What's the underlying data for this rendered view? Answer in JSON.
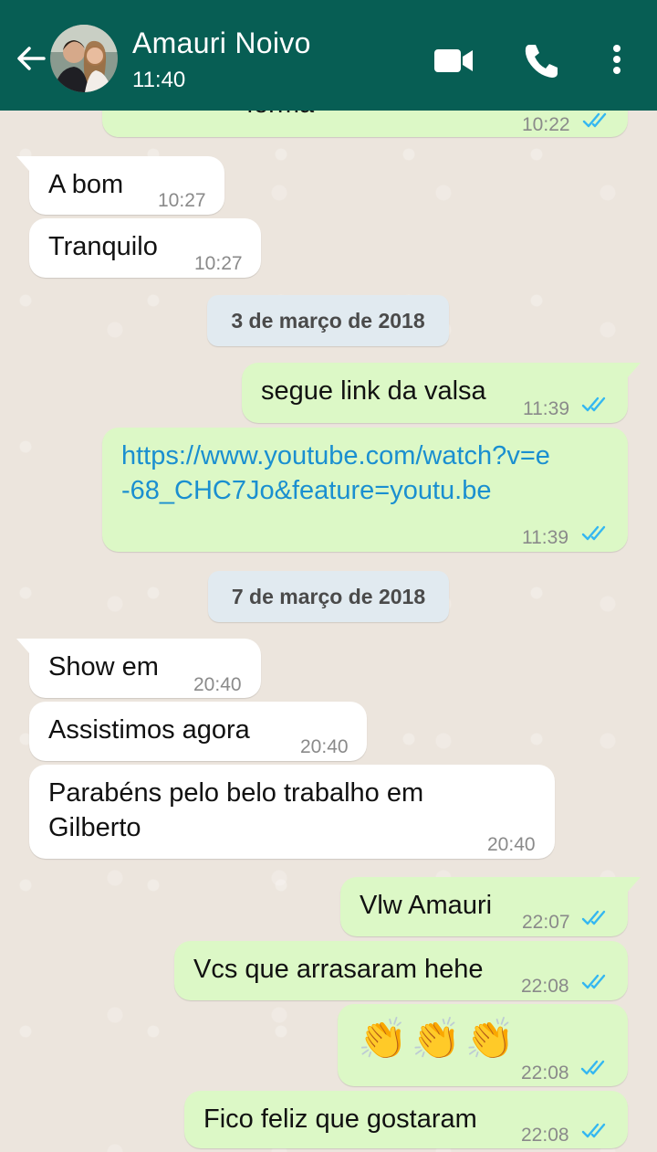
{
  "header": {
    "contact_name": "Amauri Noivo",
    "status": "11:40",
    "icons": [
      "back-arrow-icon",
      "video-call-icon",
      "phone-icon",
      "more-options-icon"
    ]
  },
  "colors": {
    "header": "#075e54",
    "outgoing_bubble": "#dcf8c6",
    "incoming_bubble": "#ffffff",
    "read_ticks": "#34b7f1",
    "link": "#1a8fd0"
  },
  "messages": [
    {
      "direction": "out",
      "text": "forma",
      "time": "10:22",
      "read": true
    },
    {
      "direction": "in",
      "text": "A bom",
      "time": "10:27"
    },
    {
      "direction": "in",
      "text": "Tranquilo",
      "time": "10:27"
    },
    {
      "direction": "date",
      "text": "3 de março de 2018"
    },
    {
      "direction": "out",
      "text": "segue link da valsa",
      "time": "11:39",
      "read": true
    },
    {
      "direction": "out",
      "text_line1": "https://www.youtube.com/watch?v=e",
      "text_line2": "-68_CHC7Jo&feature=youtu.be",
      "time": "11:39",
      "read": true
    },
    {
      "direction": "date",
      "text": "7 de março de 2018"
    },
    {
      "direction": "in",
      "text": "Show em",
      "time": "20:40"
    },
    {
      "direction": "in",
      "text": "Assistimos agora",
      "time": "20:40"
    },
    {
      "direction": "in",
      "text_line1": "Parabéns pelo belo trabalho em",
      "text_line2": "Gilberto",
      "time": "20:40"
    },
    {
      "direction": "out",
      "text": "Vlw Amauri",
      "time": "22:07",
      "read": true
    },
    {
      "direction": "out",
      "text": "Vcs que arrasaram hehe",
      "time": "22:08",
      "read": true
    },
    {
      "direction": "out",
      "text": "👏👏👏",
      "time": "22:08",
      "read": true
    },
    {
      "direction": "out",
      "text": "Fico feliz que gostaram",
      "time": "22:08",
      "read": true
    }
  ]
}
